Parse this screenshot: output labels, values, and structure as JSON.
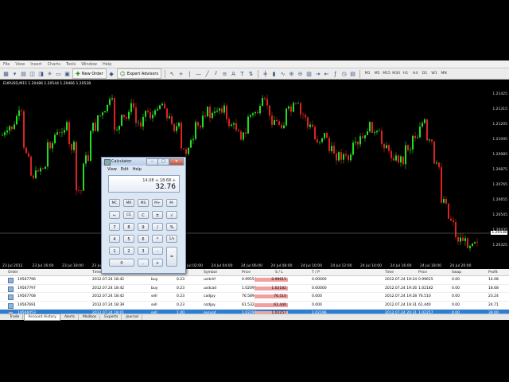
{
  "menu": [
    "File",
    "View",
    "Insert",
    "Charts",
    "Tools",
    "Window",
    "Help"
  ],
  "toolbar": {
    "new_order": "New Order",
    "expert_advisors": "Expert Advisors",
    "timeframes": [
      "M1",
      "M5",
      "M15",
      "M30",
      "H1",
      "H4",
      "D1",
      "W1",
      "MN"
    ]
  },
  "chart": {
    "symbol_line": "EURUSD,M15  1.20486 1.20544 1.20466 1.20538",
    "price_labels": [
      "1.21425",
      "1.21315",
      "1.21205",
      "1.21095",
      "1.20985",
      "1.20875",
      "1.20765",
      "1.20655",
      "1.20545",
      "1.20435",
      "1.20325"
    ],
    "current_price": "1.20538",
    "time_labels": [
      "23 Jul 2012",
      "23 Jul 16:00",
      "23 Jul 18:00",
      "23 Jul 20:00",
      "23 Jul 22:00",
      "24 Jul 00:00",
      "24 Jul 02:00",
      "24 Jul 04:00",
      "24 Jul 06:00",
      "24 Jul 08:00",
      "24 Jul 10:00",
      "24 Jul 12:00",
      "24 Jul 14:00",
      "24 Jul 16:00",
      "24 Jul 18:00",
      "24 Jul 20:00"
    ]
  },
  "terminal": {
    "headers": {
      "order": "Order",
      "time": "Time",
      "type": "Type",
      "size": "Size",
      "symbol": "Symbol",
      "price": "Price",
      "sl": "S / L",
      "tp": "T / P",
      "time2": "Time",
      "price2": "Price",
      "swap": "Swap",
      "profit": "Profit"
    },
    "rows": [
      {
        "order": "19567796",
        "time": "2012.07.24 18:42",
        "type": "buy",
        "size": "0.23",
        "symbol": "usdchf",
        "price": "0.99554",
        "sl": "0.99615",
        "tp": "0.00000",
        "time2": "2012.07.24 19:24",
        "price2": "0.99615",
        "swap": "0.00",
        "profit": "14.08"
      },
      {
        "order": "19567797",
        "time": "2012.07.24 18:42",
        "type": "buy",
        "size": "0.23",
        "symbol": "usdcad",
        "price": "1.02099",
        "sl": "1.02182",
        "tp": "0.00000",
        "time2": "2012.07.24 19:26",
        "price2": "1.02182",
        "swap": "0.00",
        "profit": "18.68"
      },
      {
        "order": "19567708",
        "time": "2012.07.24 18:42",
        "type": "sell",
        "size": "0.23",
        "symbol": "cadjpy",
        "price": "76.589",
        "sl": "76.510",
        "tp": "0.000",
        "time2": "2012.07.24 19:28",
        "price2": "76.510",
        "swap": "0.00",
        "profit": "23.24"
      },
      {
        "order": "19567691",
        "time": "2012.07.24 18:39",
        "type": "sell",
        "size": "0.23",
        "symbol": "nzdjpy",
        "price": "61.532",
        "sl": "61.440",
        "tp": "0.000",
        "time2": "2012.07.24 19:31",
        "price2": "61.440",
        "swap": "0.00",
        "profit": "24.71"
      },
      {
        "order": "19566053",
        "time": "2012.07.24 18:01",
        "type": "sell",
        "size": "1.00",
        "symbol": "eurusd",
        "price": "1.02296",
        "sl": "1.02257",
        "tp": "1.02196",
        "time2": "2012.07.24 20:31",
        "price2": "1.02257",
        "swap": "0.00",
        "profit": "39.00"
      }
    ],
    "tabs": [
      "Trade",
      "Account History",
      "Alerts",
      "Mailbox",
      "Experts",
      "Journal"
    ]
  },
  "calculator": {
    "title": "Calculator",
    "menu": [
      "View",
      "Edit",
      "Help"
    ],
    "expression": "14.08 + 18.68 +",
    "result": "32.76",
    "keys": {
      "mc": "MC",
      "mr": "MR",
      "ms": "MS",
      "mplus": "M+",
      "mminus": "M-",
      "back": "←",
      "ce": "CE",
      "c": "C",
      "pm": "±",
      "sqrt": "√",
      "n7": "7",
      "n8": "8",
      "n9": "9",
      "div": "/",
      "pct": "%",
      "n4": "4",
      "n5": "5",
      "n6": "6",
      "mul": "*",
      "inv": "1/x",
      "n1": "1",
      "n2": "2",
      "n3": "3",
      "sub": "-",
      "eq": "=",
      "n0": "0",
      "dot": ",",
      "add": "+"
    }
  }
}
